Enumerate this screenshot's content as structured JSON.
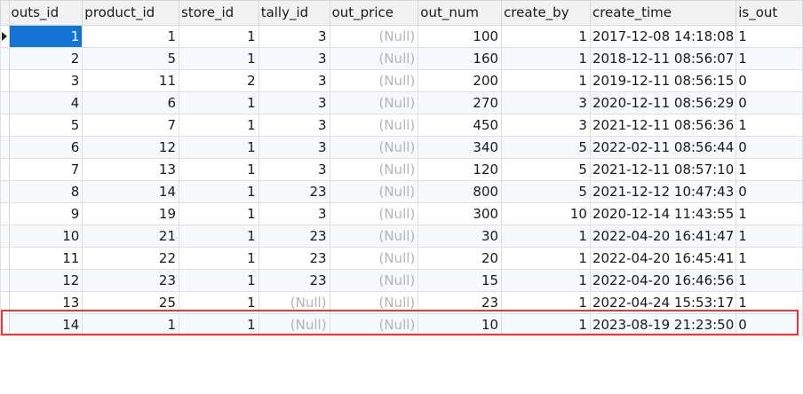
{
  "table": {
    "columns": [
      "outs_id",
      "product_id",
      "store_id",
      "tally_id",
      "out_price",
      "out_num",
      "create_by",
      "create_time",
      "is_out"
    ],
    "rows": [
      [
        "1",
        "1",
        "1",
        "3",
        "(Null)",
        "100",
        "1",
        "2017-12-08 14:18:08",
        "1"
      ],
      [
        "2",
        "5",
        "1",
        "3",
        "(Null)",
        "160",
        "1",
        "2018-12-11 08:56:07",
        "1"
      ],
      [
        "3",
        "11",
        "2",
        "3",
        "(Null)",
        "200",
        "1",
        "2019-12-11 08:56:15",
        "0"
      ],
      [
        "4",
        "6",
        "1",
        "3",
        "(Null)",
        "270",
        "3",
        "2020-12-11 08:56:29",
        "0"
      ],
      [
        "5",
        "7",
        "1",
        "3",
        "(Null)",
        "450",
        "3",
        "2021-12-11 08:56:36",
        "1"
      ],
      [
        "6",
        "12",
        "1",
        "3",
        "(Null)",
        "340",
        "5",
        "2022-02-11 08:56:44",
        "0"
      ],
      [
        "7",
        "13",
        "1",
        "3",
        "(Null)",
        "120",
        "5",
        "2021-12-11 08:57:10",
        "1"
      ],
      [
        "8",
        "14",
        "1",
        "23",
        "(Null)",
        "800",
        "5",
        "2021-12-12 10:47:43",
        "0"
      ],
      [
        "9",
        "19",
        "1",
        "3",
        "(Null)",
        "300",
        "10",
        "2020-12-14 11:43:55",
        "1"
      ],
      [
        "10",
        "21",
        "1",
        "23",
        "(Null)",
        "30",
        "1",
        "2022-04-20 16:41:47",
        "1"
      ],
      [
        "11",
        "22",
        "1",
        "23",
        "(Null)",
        "20",
        "1",
        "2022-04-20 16:45:41",
        "1"
      ],
      [
        "12",
        "23",
        "1",
        "23",
        "(Null)",
        "15",
        "1",
        "2022-04-20 16:46:56",
        "1"
      ],
      [
        "13",
        "25",
        "1",
        "(Null)",
        "(Null)",
        "23",
        "1",
        "2022-04-24 15:53:17",
        "1"
      ],
      [
        "14",
        "1",
        "1",
        "(Null)",
        "(Null)",
        "10",
        "1",
        "2023-08-19 21:23:50",
        "0"
      ]
    ]
  },
  "colors": {
    "selected_cell": "#1673d6",
    "highlight_box": "#e53935",
    "null_text": "#b4b4b4"
  }
}
